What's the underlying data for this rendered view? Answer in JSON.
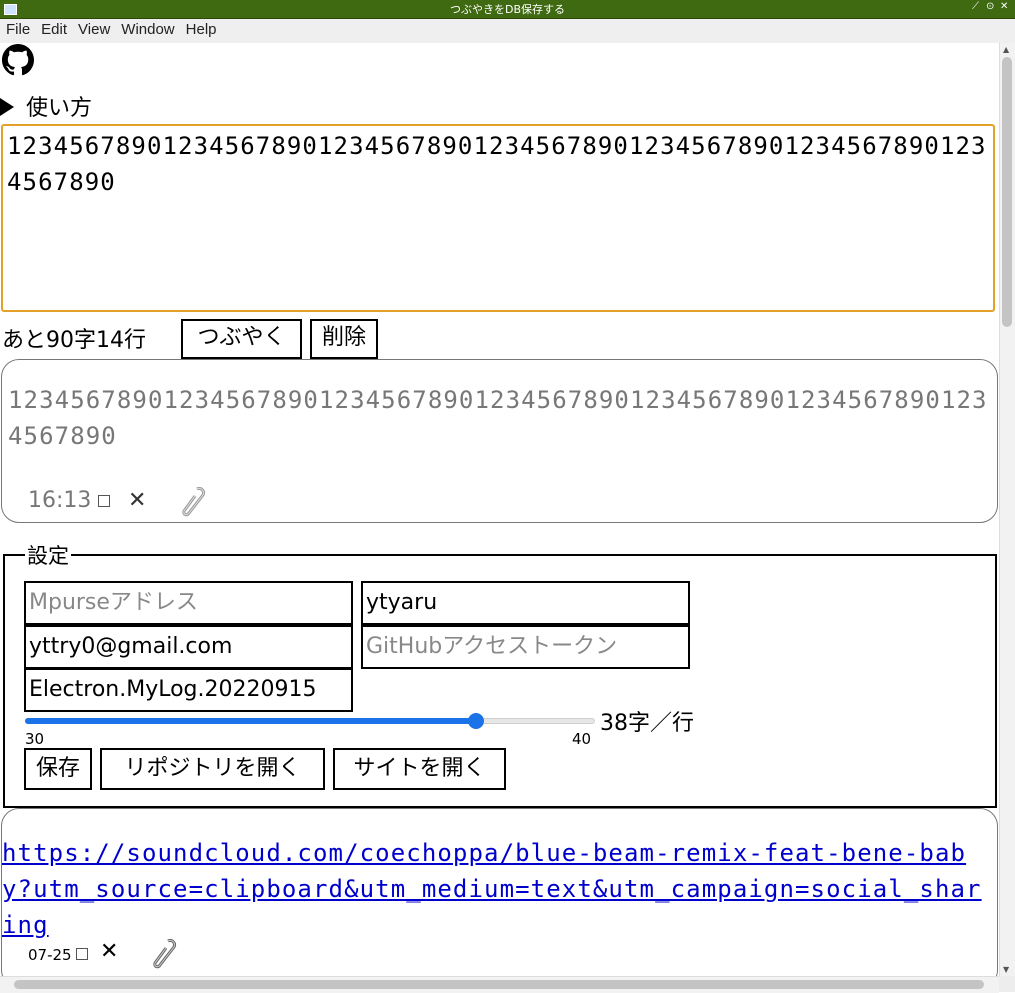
{
  "window": {
    "title": "つぶやきをDB保存する",
    "controls": [
      "⟋",
      "⊙",
      "✕"
    ]
  },
  "menu": [
    "File",
    "Edit",
    "View",
    "Window",
    "Help"
  ],
  "github_icon": "github-icon",
  "howto_label": "使い方",
  "editor": {
    "value": "1234567890123456789012345678901234567890123456789012345678901234567890"
  },
  "remaining": "あと90字14行",
  "buttons": {
    "tweet": "つぶやく",
    "delete": "削除"
  },
  "posts": [
    {
      "text": "1234567890123456789012345678901234567890123456789012345678901234567890",
      "time": "16:13",
      "is_link": false
    },
    {
      "text": "https://soundcloud.com/coechoppa/blue-beam-remix-feat-bene-baby?utm_source=clipboard&utm_medium=text&utm_campaign=social_sharing",
      "time": "07-25",
      "is_link": true
    }
  ],
  "settings": {
    "legend": "設定",
    "mpurse_placeholder": "Mpurseアドレス",
    "username": "ytyaru",
    "email": "yttry0@gmail.com",
    "token_placeholder": "GitHubアクセストークン",
    "repo": "Electron.MyLog.20220915",
    "slider": {
      "min": "30",
      "max": "40",
      "value": 38
    },
    "slider_label": "38字／行",
    "save_label": "保存",
    "open_repo_label": "リポジトリを開く",
    "open_site_label": "サイトを開く"
  },
  "colors": {
    "titlebar": "#3f6a12",
    "textarea_focus": "#e3a227",
    "slider": "#1a73e8",
    "link": "#0000cc"
  }
}
